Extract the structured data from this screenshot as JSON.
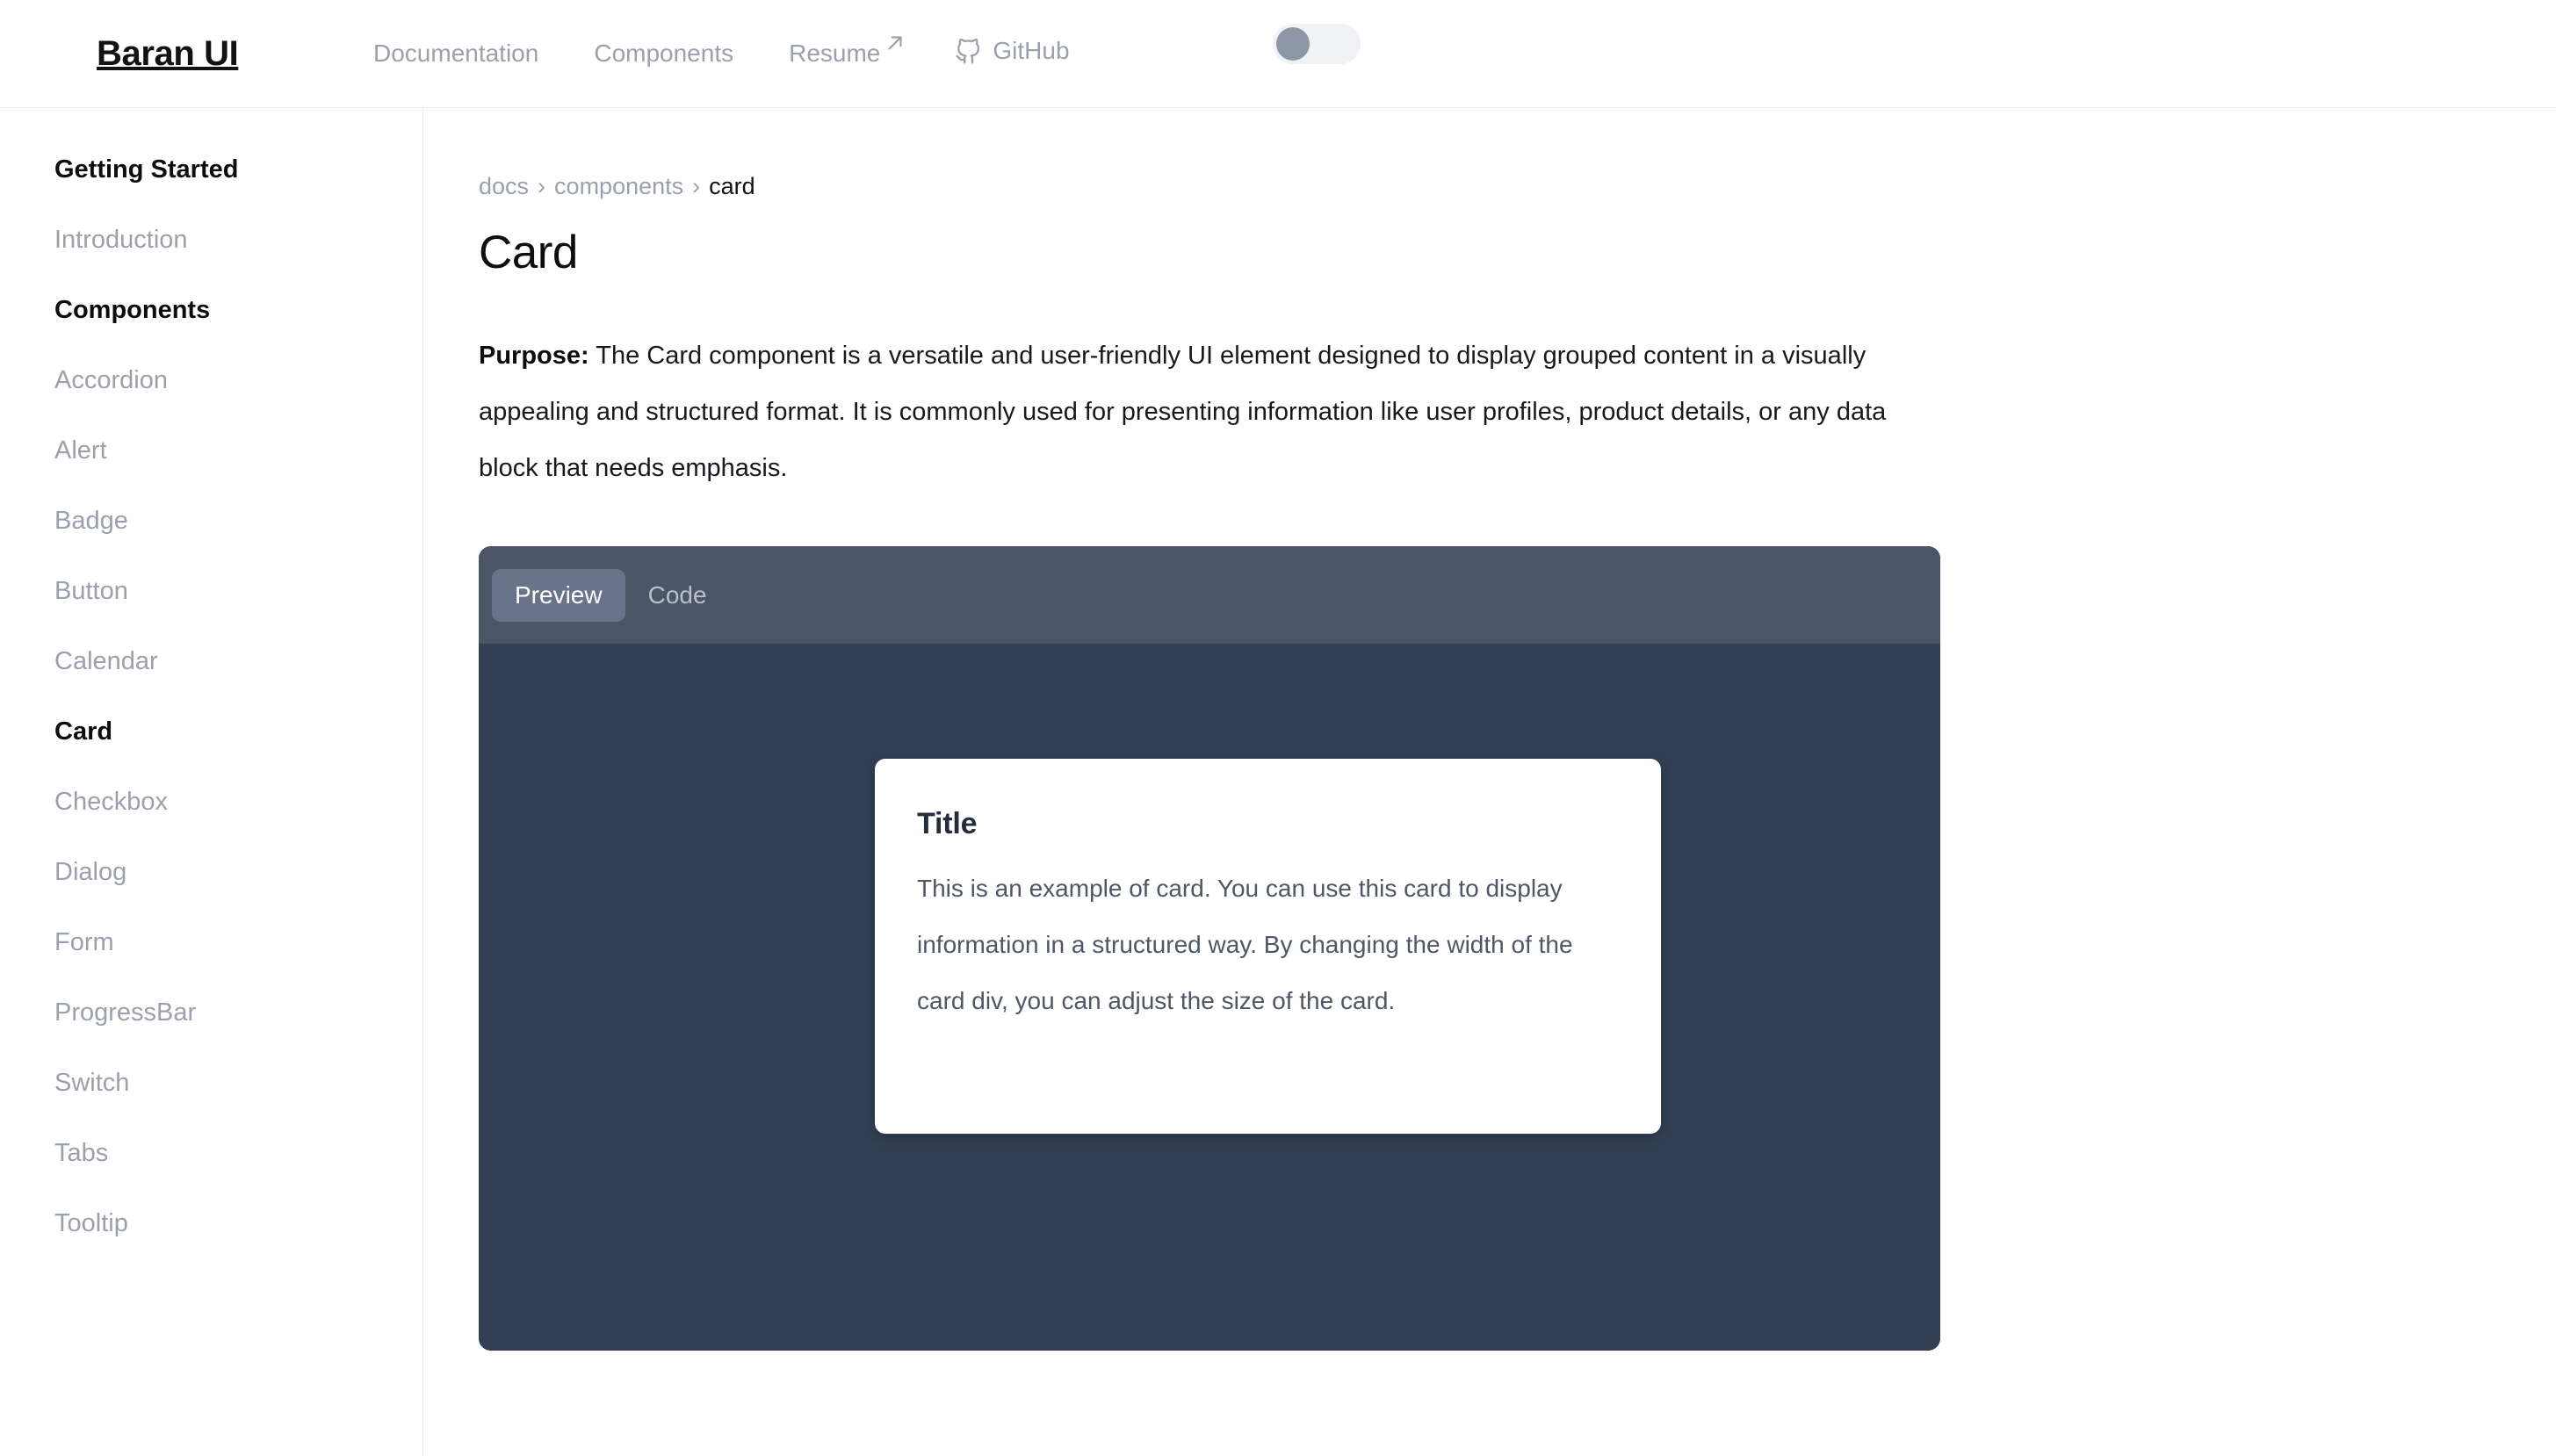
{
  "header": {
    "brand": "Baran UI",
    "nav": [
      {
        "label": "Documentation",
        "icon": null,
        "external": false
      },
      {
        "label": "Components",
        "icon": null,
        "external": false
      },
      {
        "label": "Resume",
        "icon": "external-link-icon",
        "external": true
      },
      {
        "label": "GitHub",
        "icon": "github-icon",
        "external": false
      }
    ],
    "theme_toggle": {
      "name": "theme-toggle",
      "state": "off",
      "track_color": "#f0f2f5",
      "knob_color": "#8d97a8"
    }
  },
  "sidebar": {
    "items": [
      {
        "label": "Getting Started",
        "type": "section",
        "active": false
      },
      {
        "label": "Introduction",
        "type": "link",
        "active": false
      },
      {
        "label": "Components",
        "type": "section",
        "active": false
      },
      {
        "label": "Accordion",
        "type": "link",
        "active": false
      },
      {
        "label": "Alert",
        "type": "link",
        "active": false
      },
      {
        "label": "Badge",
        "type": "link",
        "active": false
      },
      {
        "label": "Button",
        "type": "link",
        "active": false
      },
      {
        "label": "Calendar",
        "type": "link",
        "active": false
      },
      {
        "label": "Card",
        "type": "link",
        "active": true
      },
      {
        "label": "Checkbox",
        "type": "link",
        "active": false
      },
      {
        "label": "Dialog",
        "type": "link",
        "active": false
      },
      {
        "label": "Form",
        "type": "link",
        "active": false
      },
      {
        "label": "ProgressBar",
        "type": "link",
        "active": false
      },
      {
        "label": "Switch",
        "type": "link",
        "active": false
      },
      {
        "label": "Tabs",
        "type": "link",
        "active": false
      },
      {
        "label": "Tooltip",
        "type": "link",
        "active": false
      }
    ]
  },
  "main": {
    "breadcrumb": {
      "items": [
        "docs",
        "components",
        "card"
      ],
      "separator": "›"
    },
    "title": "Card",
    "purpose": {
      "label": "Purpose:",
      "text": "The Card component is a versatile and user-friendly UI element designed to display grouped content in a visually appealing and structured format. It is commonly used for presenting information like user profiles, product details, or any data block that needs emphasis."
    },
    "demo": {
      "tabs": [
        {
          "label": "Preview",
          "active": true
        },
        {
          "label": "Code",
          "active": false
        }
      ],
      "panel_bg": "#333f54",
      "tabbar_bg": "#4b5568",
      "active_tab_bg": "#69748a",
      "card": {
        "title": "Title",
        "text": "This is an example of card. You can use this card to display information in a structured way. By changing the width of the card div, you can adjust the size of the card."
      }
    }
  },
  "colors": {
    "page_bg": "#ffffff",
    "muted_text": "#9aa1ad",
    "strong_text": "#0c0d0f",
    "border": "#eceef1",
    "card_title": "#252c3b",
    "card_body": "#4e5766"
  }
}
